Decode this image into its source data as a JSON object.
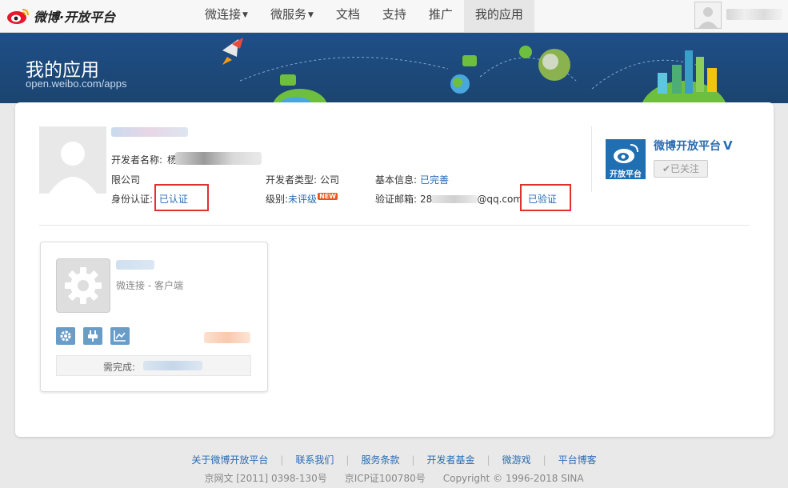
{
  "topbar": {
    "logo_text": "微博·开放平台",
    "nav": [
      {
        "label": "微连接",
        "has_caret": true
      },
      {
        "label": "微服务",
        "has_caret": true
      },
      {
        "label": "文档"
      },
      {
        "label": "支持"
      },
      {
        "label": "推广"
      },
      {
        "label": "我的应用",
        "active": true
      }
    ]
  },
  "banner": {
    "title": "我的应用",
    "subtitle": "open.weibo.com/apps"
  },
  "developer": {
    "name_label": "开发者名称:",
    "name_value_initial": "杨",
    "company_line": "限公司",
    "identity_label": "身份认证:",
    "identity_value": "已认证",
    "type_label": "开发者类型:",
    "type_value": "公司",
    "level_label": "级别:",
    "level_value": "未评级",
    "level_badge": "NEW",
    "basic_label": "基本信息:",
    "basic_value": "已完善",
    "email_label": "验证邮箱:",
    "email_prefix": "28",
    "email_suffix": "@qq.com",
    "email_status": "已验证"
  },
  "official": {
    "name": "微博开放平台",
    "logo_caption": "开放平台",
    "follow_label": "已关注"
  },
  "app_card": {
    "type": "微连接 - 客户端",
    "progress_label": "需完成:"
  },
  "footer": {
    "links": [
      "关于微博开放平台",
      "联系我们",
      "服务条款",
      "开发者基金",
      "微游戏",
      "平台博客"
    ],
    "copyright": [
      "京网文 [2011] 0398-130号",
      "京ICP证100780号",
      "Copyright © 1996-2018 SINA"
    ]
  },
  "colors": {
    "link": "#2a6cb3",
    "highlight_box": "#e03030",
    "banner_bg": "#1f4f88"
  }
}
